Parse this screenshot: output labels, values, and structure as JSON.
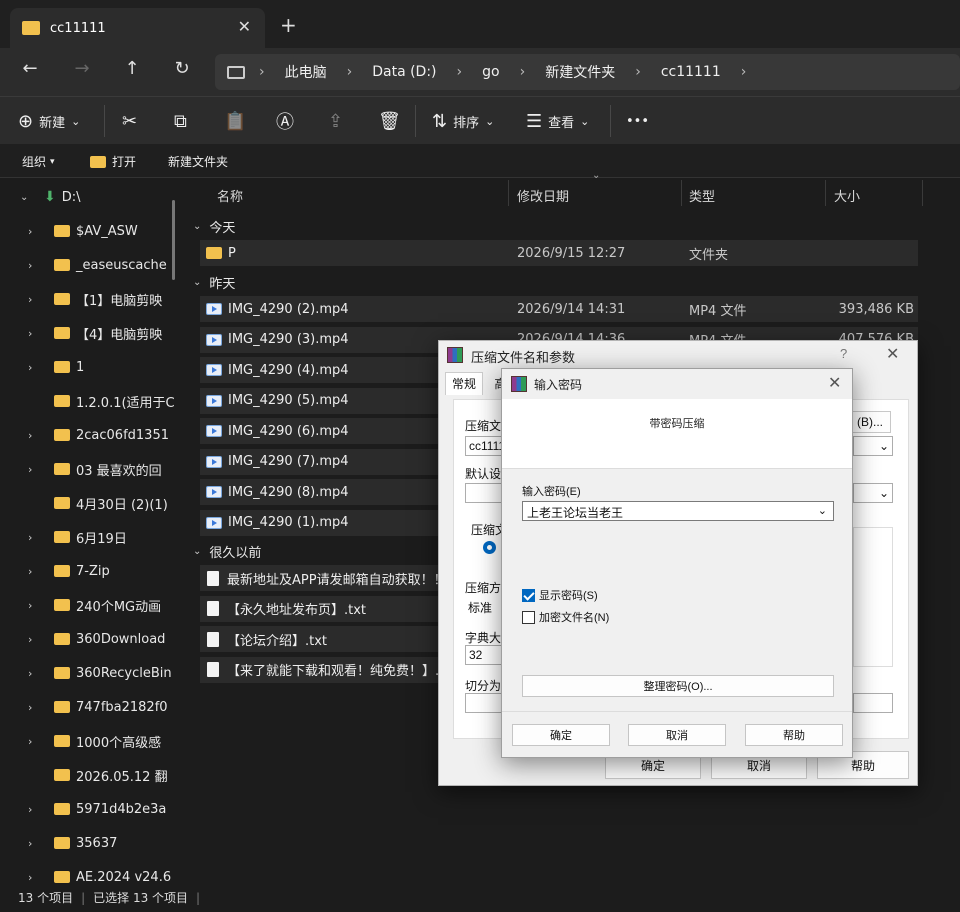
{
  "tab": {
    "title": "cc11111",
    "close": "✕",
    "new": "+"
  },
  "nav": {
    "back": "←",
    "forward": "→",
    "up": "↑",
    "refresh": "↻",
    "expand": "›"
  },
  "breadcrumbs": [
    "此电脑",
    "Data (D:)",
    "go",
    "新建文件夹",
    "cc11111"
  ],
  "breadcrumb_sep": "›",
  "commands": {
    "new": "新建",
    "sort": "排序",
    "view": "查看",
    "more": "•••",
    "cut_icon": "✂",
    "copy_icon": "⧉",
    "paste_icon": "📋",
    "rename_icon": "Ⓐ",
    "share_icon": "⇪",
    "delete_icon": "🗑",
    "new_icon": "⊕",
    "sort_icon": "⇅",
    "view_icon": "☰",
    "caret": "⌄"
  },
  "subbar": {
    "organize": "组织",
    "open": "打开",
    "new_folder": "新建文件夹",
    "caret": "▾"
  },
  "sidebar": {
    "drive": "D:\\",
    "items": [
      {
        "label": "$AV_ASW",
        "chev": "›"
      },
      {
        "label": "_easeuscache",
        "chev": "›"
      },
      {
        "label": "【1】电脑剪映",
        "chev": "›"
      },
      {
        "label": "【4】电脑剪映",
        "chev": "›"
      },
      {
        "label": "1",
        "chev": "›"
      },
      {
        "label": "1.2.0.1(适用于C",
        "chev": ""
      },
      {
        "label": "2cac06fd1351",
        "chev": "›"
      },
      {
        "label": "03 最喜欢的回",
        "chev": "›"
      },
      {
        "label": "4月30日 (2)(1)",
        "chev": ""
      },
      {
        "label": "6月19日",
        "chev": "›"
      },
      {
        "label": "7-Zip",
        "chev": "›"
      },
      {
        "label": "240个MG动画",
        "chev": "›"
      },
      {
        "label": "360Download",
        "chev": "›"
      },
      {
        "label": "360RecycleBin",
        "chev": "›"
      },
      {
        "label": "747fba2182f0",
        "chev": "›"
      },
      {
        "label": "1000个高级感",
        "chev": "›"
      },
      {
        "label": "2026.05.12 翻",
        "chev": ""
      },
      {
        "label": "5971d4b2e3a",
        "chev": "›"
      },
      {
        "label": "35637",
        "chev": "›"
      },
      {
        "label": "AE.2024 v24.6",
        "chev": "›"
      }
    ]
  },
  "columns": {
    "name": "名称",
    "date": "修改日期",
    "type": "类型",
    "size": "大小",
    "sort_caret": "⌄"
  },
  "groups": {
    "today": "今天",
    "yesterday": "昨天",
    "older": "很久以前",
    "chev": "⌄"
  },
  "files_today": [
    {
      "name": "P",
      "date": "2026/9/15 12:27",
      "type": "文件夹",
      "size": ""
    }
  ],
  "files_yesterday": [
    {
      "name": "IMG_4290 (2).mp4",
      "date": "2026/9/14 14:31",
      "type": "MP4 文件",
      "size": "393,486 KB"
    },
    {
      "name": "IMG_4290 (3).mp4",
      "date": "2026/9/14 14:36",
      "type": "MP4 文件",
      "size": "407,576 KB"
    },
    {
      "name": "IMG_4290 (4).mp4",
      "date": "",
      "type": "",
      "size": ""
    },
    {
      "name": "IMG_4290 (5).mp4",
      "date": "",
      "type": "",
      "size": ""
    },
    {
      "name": "IMG_4290 (6).mp4",
      "date": "",
      "type": "",
      "size": ""
    },
    {
      "name": "IMG_4290 (7).mp4",
      "date": "",
      "type": "",
      "size": ""
    },
    {
      "name": "IMG_4290 (8).mp4",
      "date": "",
      "type": "",
      "size": ""
    },
    {
      "name": "IMG_4290 (1).mp4",
      "date": "",
      "type": "",
      "size": ""
    }
  ],
  "files_older": [
    {
      "name": "最新地址及APP请发邮箱自动获取！！"
    },
    {
      "name": "【永久地址发布页】.txt"
    },
    {
      "name": "【论坛介绍】.txt"
    },
    {
      "name": "【来了就能下载和观看！纯免费！】.t"
    }
  ],
  "status": {
    "count": "13 个项目",
    "selected": "已选择 13 个项目"
  },
  "archive_dialog": {
    "title": "压缩文件名和参数",
    "help": "?",
    "close": "✕",
    "tab_general": "常规",
    "tab_second": "高",
    "archive_name_label": "压缩文件",
    "archive_name_value": "cc1111",
    "browse": "(B)...",
    "default_label": "默认设",
    "format_label": "压缩文",
    "method_label": "压缩方",
    "method_value": "标准",
    "dict_label": "字典大小",
    "dict_value": "32",
    "split_label": "切分为",
    "ok": "确定",
    "cancel": "取消",
    "help_btn": "帮助",
    "dropdown_caret": "⌄"
  },
  "password_dialog": {
    "title": "输入密码",
    "close": "✕",
    "header": "带密码压缩",
    "enter_label": "输入密码(E)",
    "password_value": "上老王论坛当老王",
    "dropdown_caret": "⌄",
    "show_password": "显示密码(S)",
    "encrypt_names": "加密文件名(N)",
    "organize": "整理密码(O)...",
    "ok": "确定",
    "cancel": "取消",
    "help": "帮助",
    "show_password_checked": true,
    "encrypt_names_checked": false
  }
}
